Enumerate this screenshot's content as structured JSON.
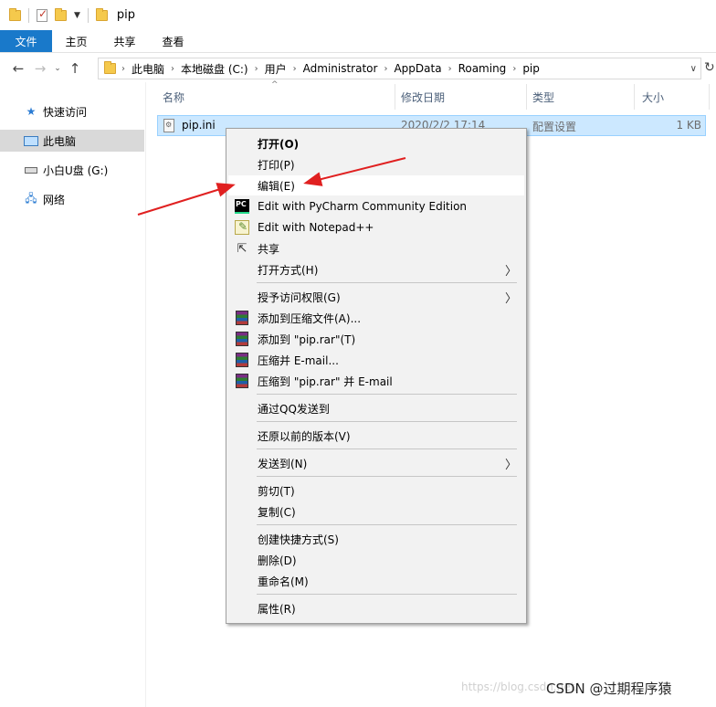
{
  "window": {
    "title": "pip"
  },
  "ribbon": {
    "tabs": [
      "文件",
      "主页",
      "共享",
      "查看"
    ]
  },
  "address": {
    "crumbs": [
      "此电脑",
      "本地磁盘 (C:)",
      "用户",
      "Administrator",
      "AppData",
      "Roaming",
      "pip"
    ]
  },
  "sidebar": {
    "items": [
      {
        "label": "快速访问",
        "icon": "star-icon"
      },
      {
        "label": "此电脑",
        "icon": "computer-icon"
      },
      {
        "label": "小白U盘 (G:)",
        "icon": "usb-drive-icon"
      },
      {
        "label": "网络",
        "icon": "network-icon"
      }
    ]
  },
  "columns": {
    "name": "名称",
    "modified": "修改日期",
    "type": "类型",
    "size": "大小"
  },
  "file": {
    "name": "pip.ini",
    "modified": "2020/2/2 17:14",
    "type": "配置设置",
    "size": "1 KB"
  },
  "context_menu": {
    "open": "打开(O)",
    "print": "打印(P)",
    "edit": "编辑(E)",
    "pycharm": "Edit with PyCharm Community Edition",
    "notepadpp": "Edit with Notepad++",
    "share": "共享",
    "open_with": "打开方式(H)",
    "grant_access": "授予访问权限(G)",
    "add_to_archive": "添加到压缩文件(A)...",
    "add_to_rar": "添加到 \"pip.rar\"(T)",
    "compress_email": "压缩并 E-mail...",
    "compress_rar_email": "压缩到 \"pip.rar\" 并 E-mail",
    "send_qq": "通过QQ发送到",
    "restore": "还原以前的版本(V)",
    "send_to": "发送到(N)",
    "cut": "剪切(T)",
    "copy": "复制(C)",
    "create_shortcut": "创建快捷方式(S)",
    "delete": "删除(D)",
    "rename": "重命名(M)",
    "properties": "属性(R)"
  },
  "watermark": {
    "faint": "https://blog.csdn.net/",
    "text": "CSDN @过期程序猿"
  },
  "colors": {
    "file_tab": "#1979ca",
    "selection": "#cce8ff",
    "annotation_arrow": "#e02020"
  }
}
